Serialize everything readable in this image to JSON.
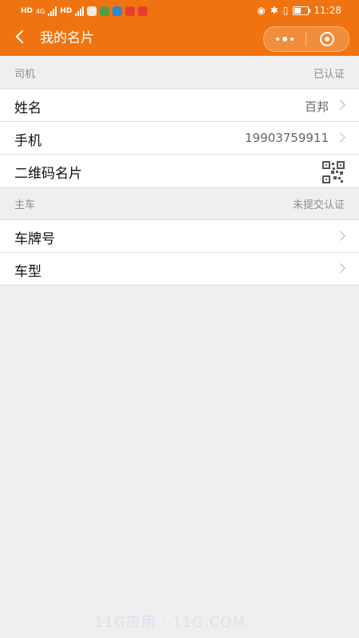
{
  "status_bar": {
    "time": "11:28",
    "network_left_1": "HD",
    "network_left_2": "4G",
    "network_left_3": "HD",
    "battery_icon": "battery-icon",
    "icons": [
      "wifi-icon",
      "bluetooth-icon",
      "eye-icon",
      "vibrate-icon"
    ]
  },
  "header": {
    "title": "我的名片",
    "back_icon": "back-icon",
    "more_icon": "more-icon",
    "close_icon": "close-icon"
  },
  "sections": [
    {
      "name": "司机",
      "status": "已认证"
    },
    {
      "name": "主车",
      "status": "未提交认证"
    }
  ],
  "rows": {
    "name": {
      "label": "姓名",
      "value": "百邦"
    },
    "phone": {
      "label": "手机",
      "value": "19903759911"
    },
    "qr": {
      "label": "二维码名片",
      "icon": "qr-code-icon"
    },
    "plate": {
      "label": "车牌号"
    },
    "model": {
      "label": "车型"
    }
  },
  "watermark": "11G应用 · 11G.COM"
}
